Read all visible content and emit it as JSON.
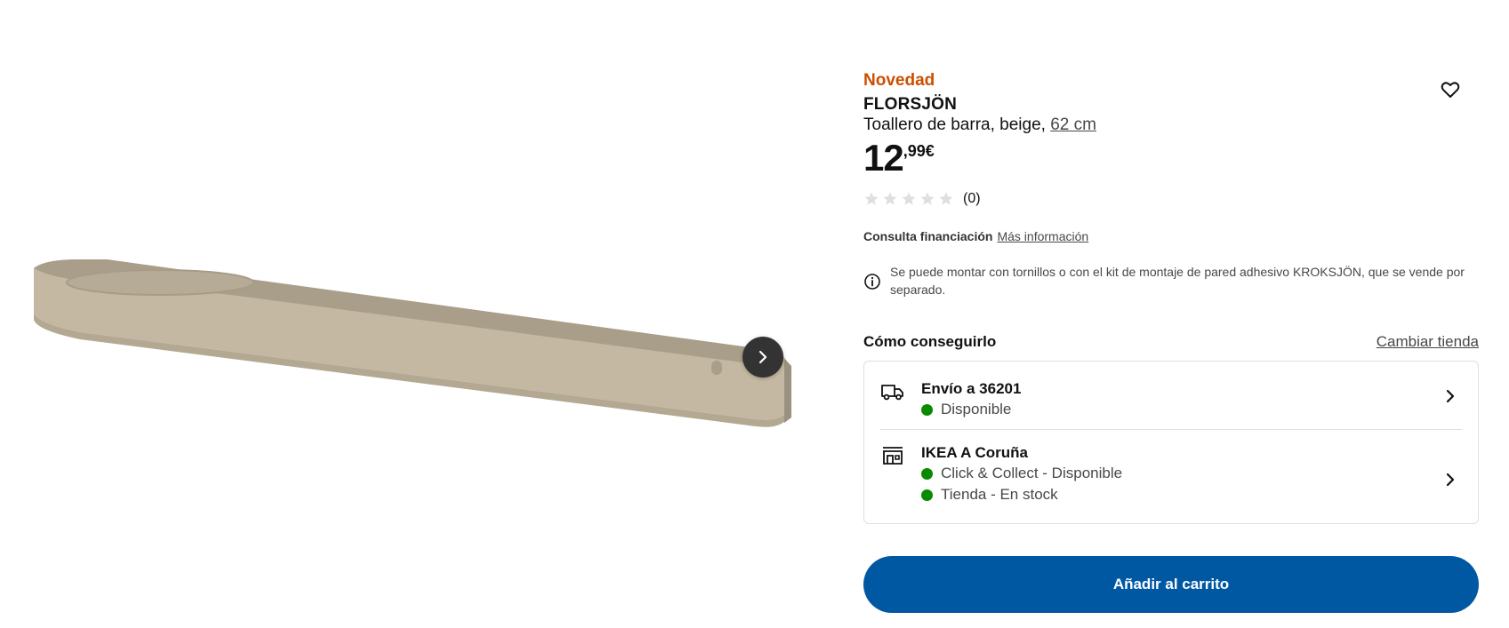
{
  "gallery": {
    "image_alt": "FLORSJÖN toallero de barra beige",
    "colors": {
      "body": "#c4b8a2",
      "shade": "#a79c88",
      "inner": "#9b917f"
    }
  },
  "product": {
    "badge": "Novedad",
    "name": "FLORSJÖN",
    "description": "Toallero de barra, beige,",
    "size": "62 cm",
    "price_integer": "12",
    "price_decimals": ",99€",
    "rating": 0,
    "rating_count": "(0)"
  },
  "financing": {
    "label": "Consulta financiación",
    "link": "Más información"
  },
  "notice": {
    "text": "Se puede montar con tornillos o con el kit de montaje de pared adhesivo KROKSJÖN, que se vende por separado."
  },
  "availability": {
    "title": "Cómo conseguirlo",
    "change_store": "Cambiar tienda",
    "delivery": {
      "title": "Envío a 36201",
      "status": "Disponible"
    },
    "store": {
      "title": "IKEA A Coruña",
      "statuses": [
        "Click & Collect - Disponible",
        "Tienda - En stock"
      ]
    },
    "status_color": "#0a8a00"
  },
  "cart": {
    "label": "Añadir al carrito",
    "color": "#0058a3"
  },
  "icons": {
    "next": "chevron-right-icon",
    "wishlist": "heart-icon",
    "info": "info-icon",
    "delivery": "truck-icon",
    "store": "store-icon"
  }
}
